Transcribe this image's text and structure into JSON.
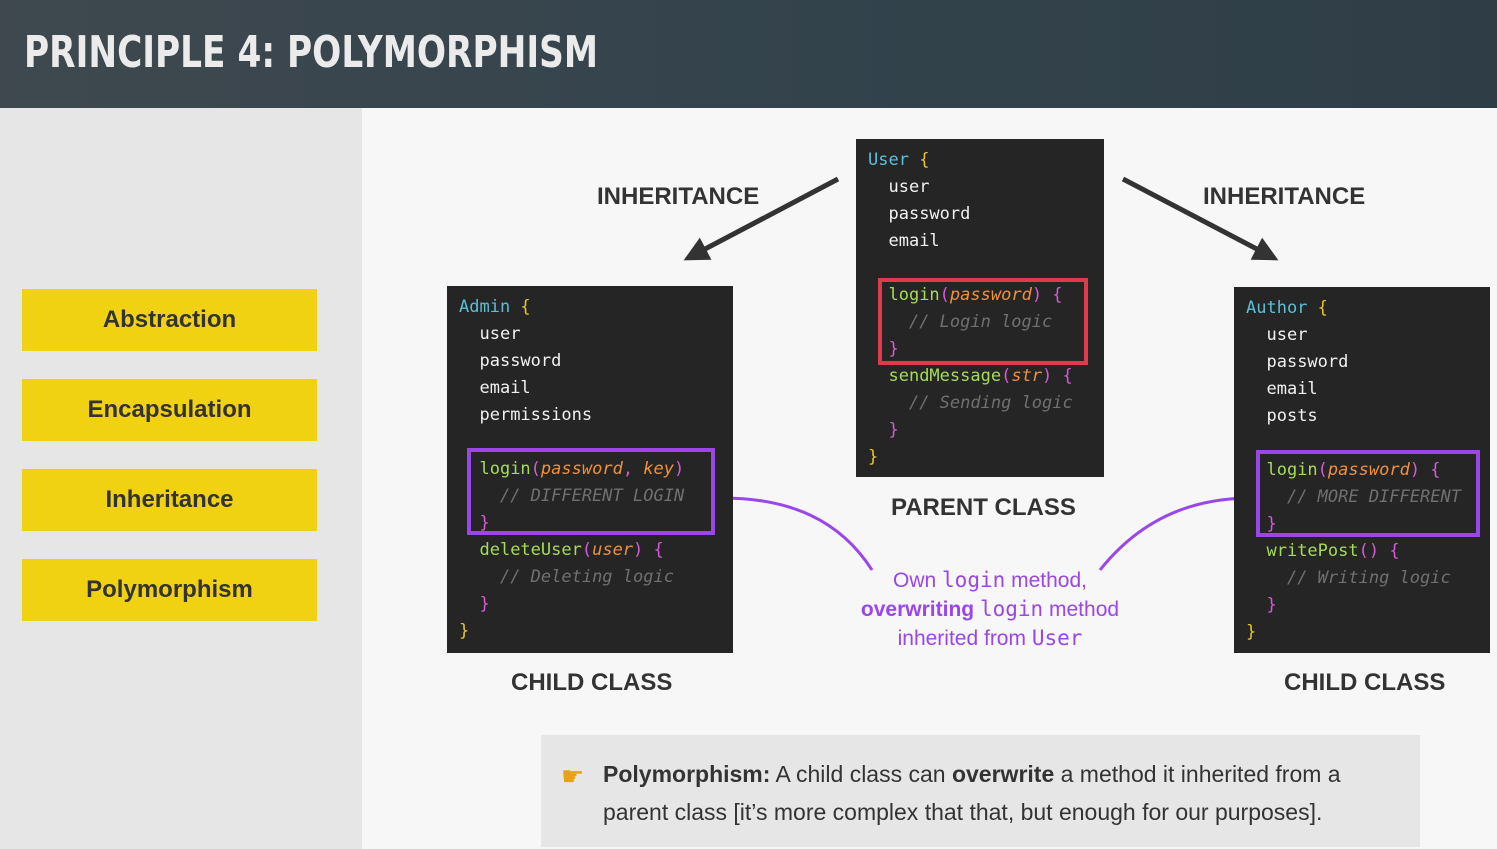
{
  "header": {
    "title": "PRINCIPLE 4: POLYMORPHISM"
  },
  "sidebar": {
    "items": [
      {
        "label": "Abstraction"
      },
      {
        "label": "Encapsulation"
      },
      {
        "label": "Inheritance"
      },
      {
        "label": "Polymorphism"
      }
    ]
  },
  "diagram": {
    "inheritance_left": "INHERITANCE",
    "inheritance_right": "INHERITANCE",
    "parent_label": "PARENT CLASS",
    "child_left_label": "CHILD CLASS",
    "child_right_label": "CHILD CLASS",
    "parent": {
      "class_name": "User",
      "fields": [
        "user",
        "password",
        "email"
      ],
      "login_fn": "login",
      "login_param": "password",
      "login_comment": "// Login logic",
      "send_fn": "sendMessage",
      "send_param": "str",
      "send_comment": "// Sending logic"
    },
    "admin": {
      "class_name": "Admin",
      "fields": [
        "user",
        "password",
        "email",
        "permissions"
      ],
      "login_fn": "login",
      "login_param1": "password",
      "login_param2": "key",
      "login_comment": "// DIFFERENT LOGIN",
      "delete_fn": "deleteUser",
      "delete_param": "user",
      "delete_comment": "// Deleting logic"
    },
    "author": {
      "class_name": "Author",
      "fields": [
        "user",
        "password",
        "email",
        "posts"
      ],
      "login_fn": "login",
      "login_param": "password",
      "login_comment": "// MORE DIFFERENT",
      "write_fn": "writePost",
      "write_comment": "// Writing logic"
    },
    "callout": {
      "line1_a": "Own ",
      "line1_code": "login",
      "line1_b": " method,",
      "line2_bold": "overwriting",
      "line2_code": "login",
      "line2_b": " method",
      "line3_a": "inherited from ",
      "line3_code": "User"
    }
  },
  "note": {
    "bold": "Polymorphism:",
    "text_a": " A child class can ",
    "bold2": "overwrite",
    "text_b": " a method it inherited from a parent class [it’s more complex that that, but enough for our purposes]."
  },
  "colors": {
    "pill": "#f1d213",
    "highlight_red": "#e23a4d",
    "highlight_purple": "#9a46e8",
    "code_bg": "#252526"
  }
}
